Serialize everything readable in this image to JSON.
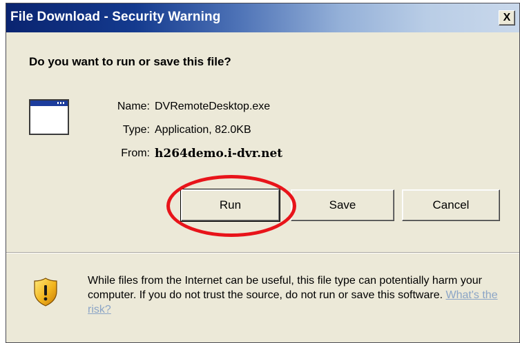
{
  "window": {
    "title": "File Download - Security Warning",
    "close_label": "X"
  },
  "prompt": {
    "question": "Do you want to run or save this file?"
  },
  "file_info": {
    "name_label": "Name:",
    "name_value": "DVRemoteDesktop.exe",
    "type_label": "Type:",
    "type_value": "Application, 82.0KB",
    "from_label": "From:",
    "from_value": "h264demo.i-dvr.net",
    "icon": "application-window-icon"
  },
  "buttons": {
    "run": "Run",
    "save": "Save",
    "cancel": "Cancel"
  },
  "annotation": {
    "highlight": "red-ellipse-around-run-button",
    "color": "#e8141a"
  },
  "warning": {
    "icon": "shield-warning-icon",
    "text": "While files from the Internet can be useful, this file type can potentially harm your computer. If you do not trust the source, do not run or save this software.",
    "link_text": "What's the risk?"
  },
  "colors": {
    "titlebar_start": "#0a2470",
    "titlebar_end": "#c9d8eb",
    "dialog_bg": "#ece9d8",
    "link": "#8aa4c6"
  }
}
